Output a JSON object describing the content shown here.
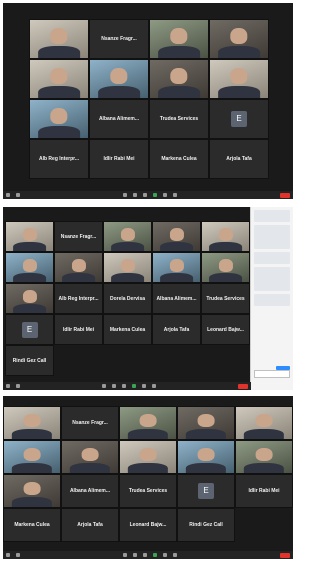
{
  "shot1": {
    "tiles": [
      {
        "type": "video",
        "label": ""
      },
      {
        "type": "name",
        "label": "Nsanze Fragr..."
      },
      {
        "type": "video",
        "label": ""
      },
      {
        "type": "video",
        "label": ""
      },
      {
        "type": "video",
        "label": ""
      },
      {
        "type": "video",
        "label": ""
      },
      {
        "type": "video",
        "label": ""
      },
      {
        "type": "video",
        "label": ""
      },
      {
        "type": "video",
        "label": ""
      },
      {
        "type": "name",
        "label": "Albana Alimem..."
      },
      {
        "type": "name",
        "label": "Trudea Services"
      },
      {
        "type": "avatar",
        "label": "E"
      },
      {
        "type": "name",
        "label": "Alb Reg Interpr..."
      },
      {
        "type": "name",
        "label": "Idlir Rabi Mei"
      },
      {
        "type": "name",
        "label": "Markena Culea"
      },
      {
        "type": "name",
        "label": "Arjola Tafa"
      }
    ]
  },
  "shot2": {
    "tiles": [
      {
        "type": "video",
        "label": ""
      },
      {
        "type": "name",
        "label": "Nsanze Fragr..."
      },
      {
        "type": "video",
        "label": ""
      },
      {
        "type": "video",
        "label": ""
      },
      {
        "type": "video",
        "label": ""
      },
      {
        "type": "video",
        "label": ""
      },
      {
        "type": "video",
        "label": ""
      },
      {
        "type": "video",
        "label": ""
      },
      {
        "type": "video",
        "label": ""
      },
      {
        "type": "video",
        "label": ""
      },
      {
        "type": "video",
        "label": ""
      },
      {
        "type": "name",
        "label": "Alb Reg Interpr..."
      },
      {
        "type": "name",
        "label": "Dorela Dervisa"
      },
      {
        "type": "name",
        "label": "Albana Alimem..."
      },
      {
        "type": "name",
        "label": "Trudea Services"
      },
      {
        "type": "avatar",
        "label": "E"
      },
      {
        "type": "name",
        "label": "Idlir Rabi Mei"
      },
      {
        "type": "name",
        "label": "Markena Culea"
      },
      {
        "type": "name",
        "label": "Arjola Tafa"
      },
      {
        "type": "name",
        "label": "Leonard Bajw..."
      },
      {
        "type": "name",
        "label": "Rindi Gez Call"
      }
    ]
  },
  "shot3": {
    "tiles": [
      {
        "type": "video",
        "label": ""
      },
      {
        "type": "name",
        "label": "Nsanze Fragr..."
      },
      {
        "type": "video",
        "label": ""
      },
      {
        "type": "video",
        "label": ""
      },
      {
        "type": "video",
        "label": ""
      },
      {
        "type": "video",
        "label": ""
      },
      {
        "type": "video",
        "label": ""
      },
      {
        "type": "video",
        "label": ""
      },
      {
        "type": "video",
        "label": ""
      },
      {
        "type": "video",
        "label": ""
      },
      {
        "type": "video",
        "label": ""
      },
      {
        "type": "name",
        "label": "Albana Alimem..."
      },
      {
        "type": "name",
        "label": "Trudea Services"
      },
      {
        "type": "avatar",
        "label": "E"
      },
      {
        "type": "name",
        "label": "Idlir Rabi Mei"
      },
      {
        "type": "name",
        "label": "Markena Culea"
      },
      {
        "type": "name",
        "label": "Arjola Tafa"
      },
      {
        "type": "name",
        "label": "Leonard Bajw..."
      },
      {
        "type": "name",
        "label": "Rindi Gez Call"
      }
    ]
  },
  "colors": {
    "meeting_bg": "#1a1a1a",
    "end_button": "#e0332c",
    "mic_active": "#3aa655",
    "chat_send": "#2d8cff"
  },
  "icons": [
    "mute-icon",
    "video-icon",
    "security-icon",
    "participants-icon",
    "chat-icon",
    "share-screen-icon",
    "record-icon",
    "reactions-icon"
  ]
}
